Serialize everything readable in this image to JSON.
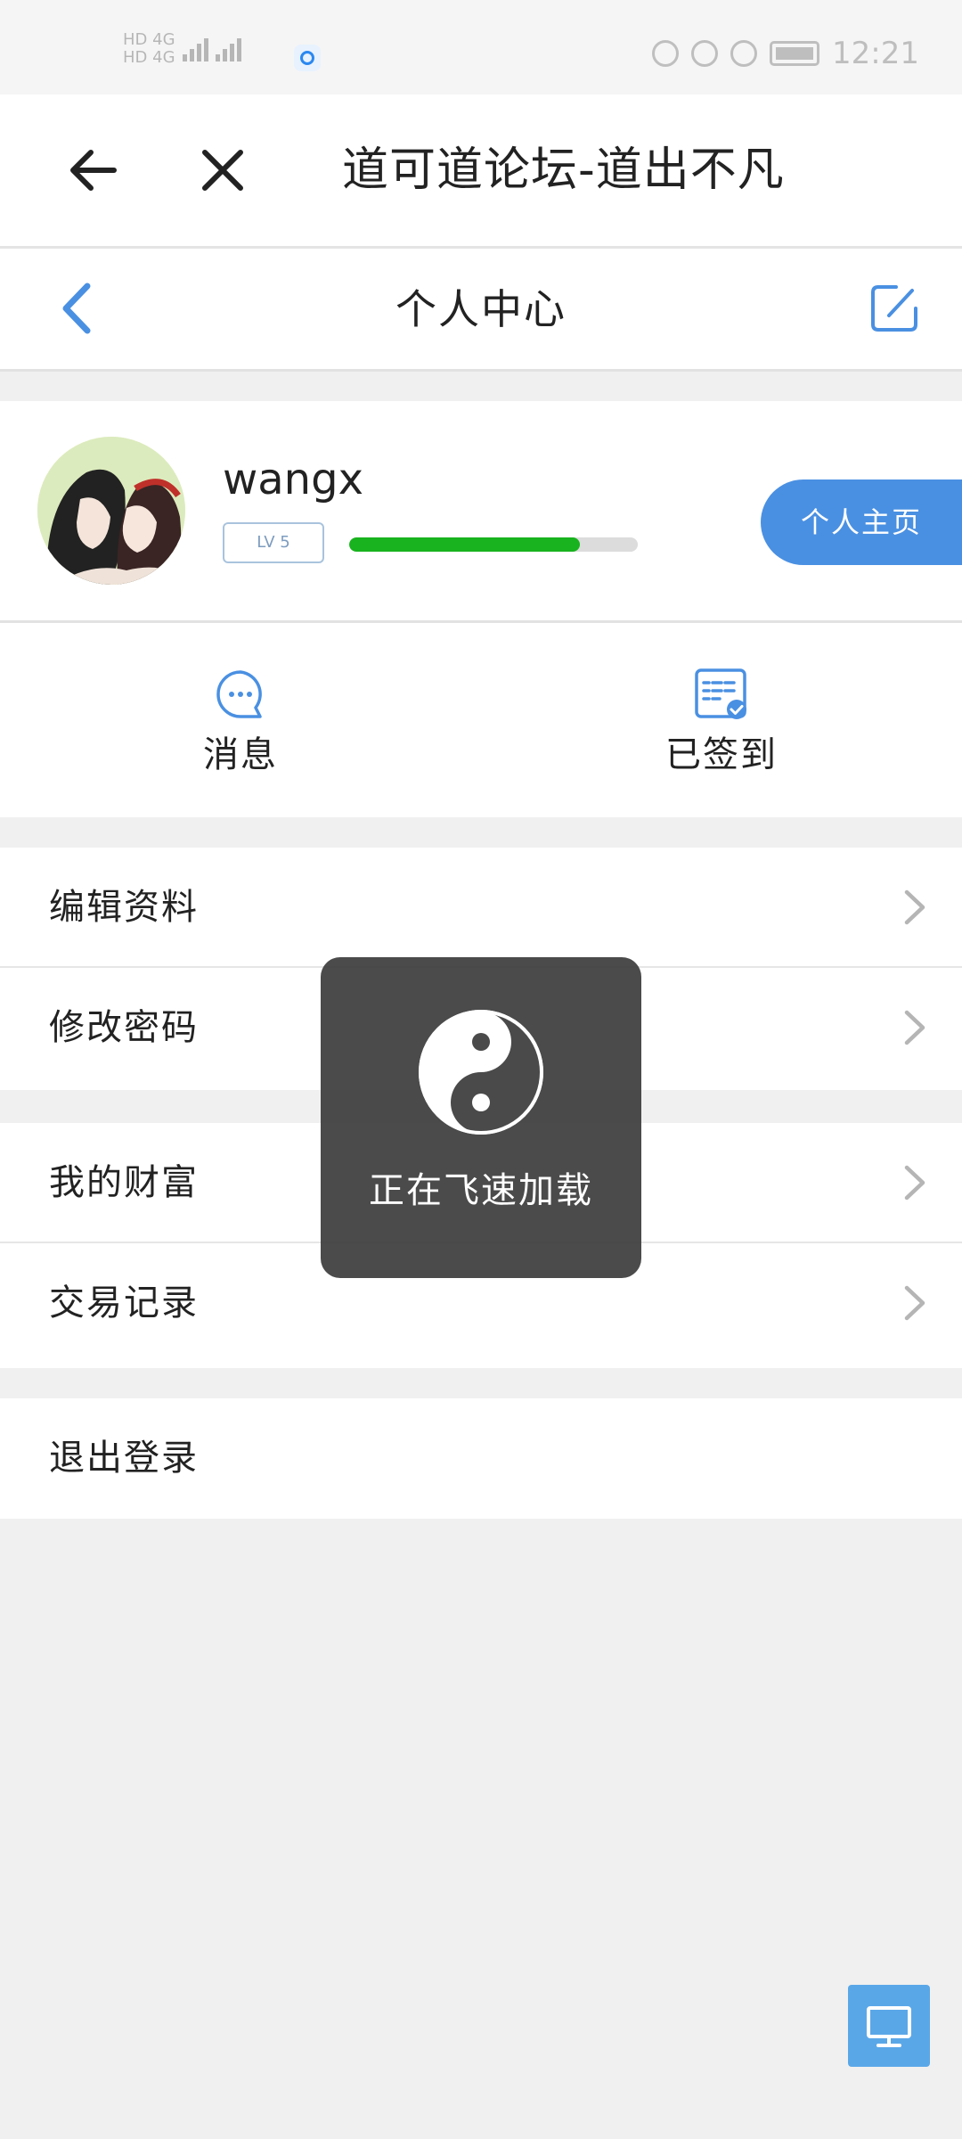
{
  "status_bar": {
    "carrier_top": "HD 4G",
    "carrier_bottom": "HD 4G",
    "time": "12:21"
  },
  "browser_bar": {
    "title": "道可道论坛-道出不凡",
    "back_icon": "arrow-left-icon",
    "close_icon": "close-icon"
  },
  "header": {
    "title": "个人中心",
    "back_icon": "chevron-left-icon",
    "edit_icon": "edit-icon"
  },
  "profile": {
    "username": "wangx",
    "level": "LV 5",
    "level_progress": 0.8,
    "home_button": "个人主页"
  },
  "quick_actions": {
    "messages": "消息",
    "checkin": "已签到"
  },
  "menu": {
    "group1": [
      "编辑资料",
      "修改密码"
    ],
    "group2": [
      "我的财富",
      "交易记录"
    ],
    "group3": [
      "退出登录"
    ]
  },
  "loading": {
    "text": "正在飞速加载"
  },
  "colors": {
    "accent": "#4a90e2",
    "progress": "#18b31e",
    "overlay": "#3c3c3c"
  }
}
